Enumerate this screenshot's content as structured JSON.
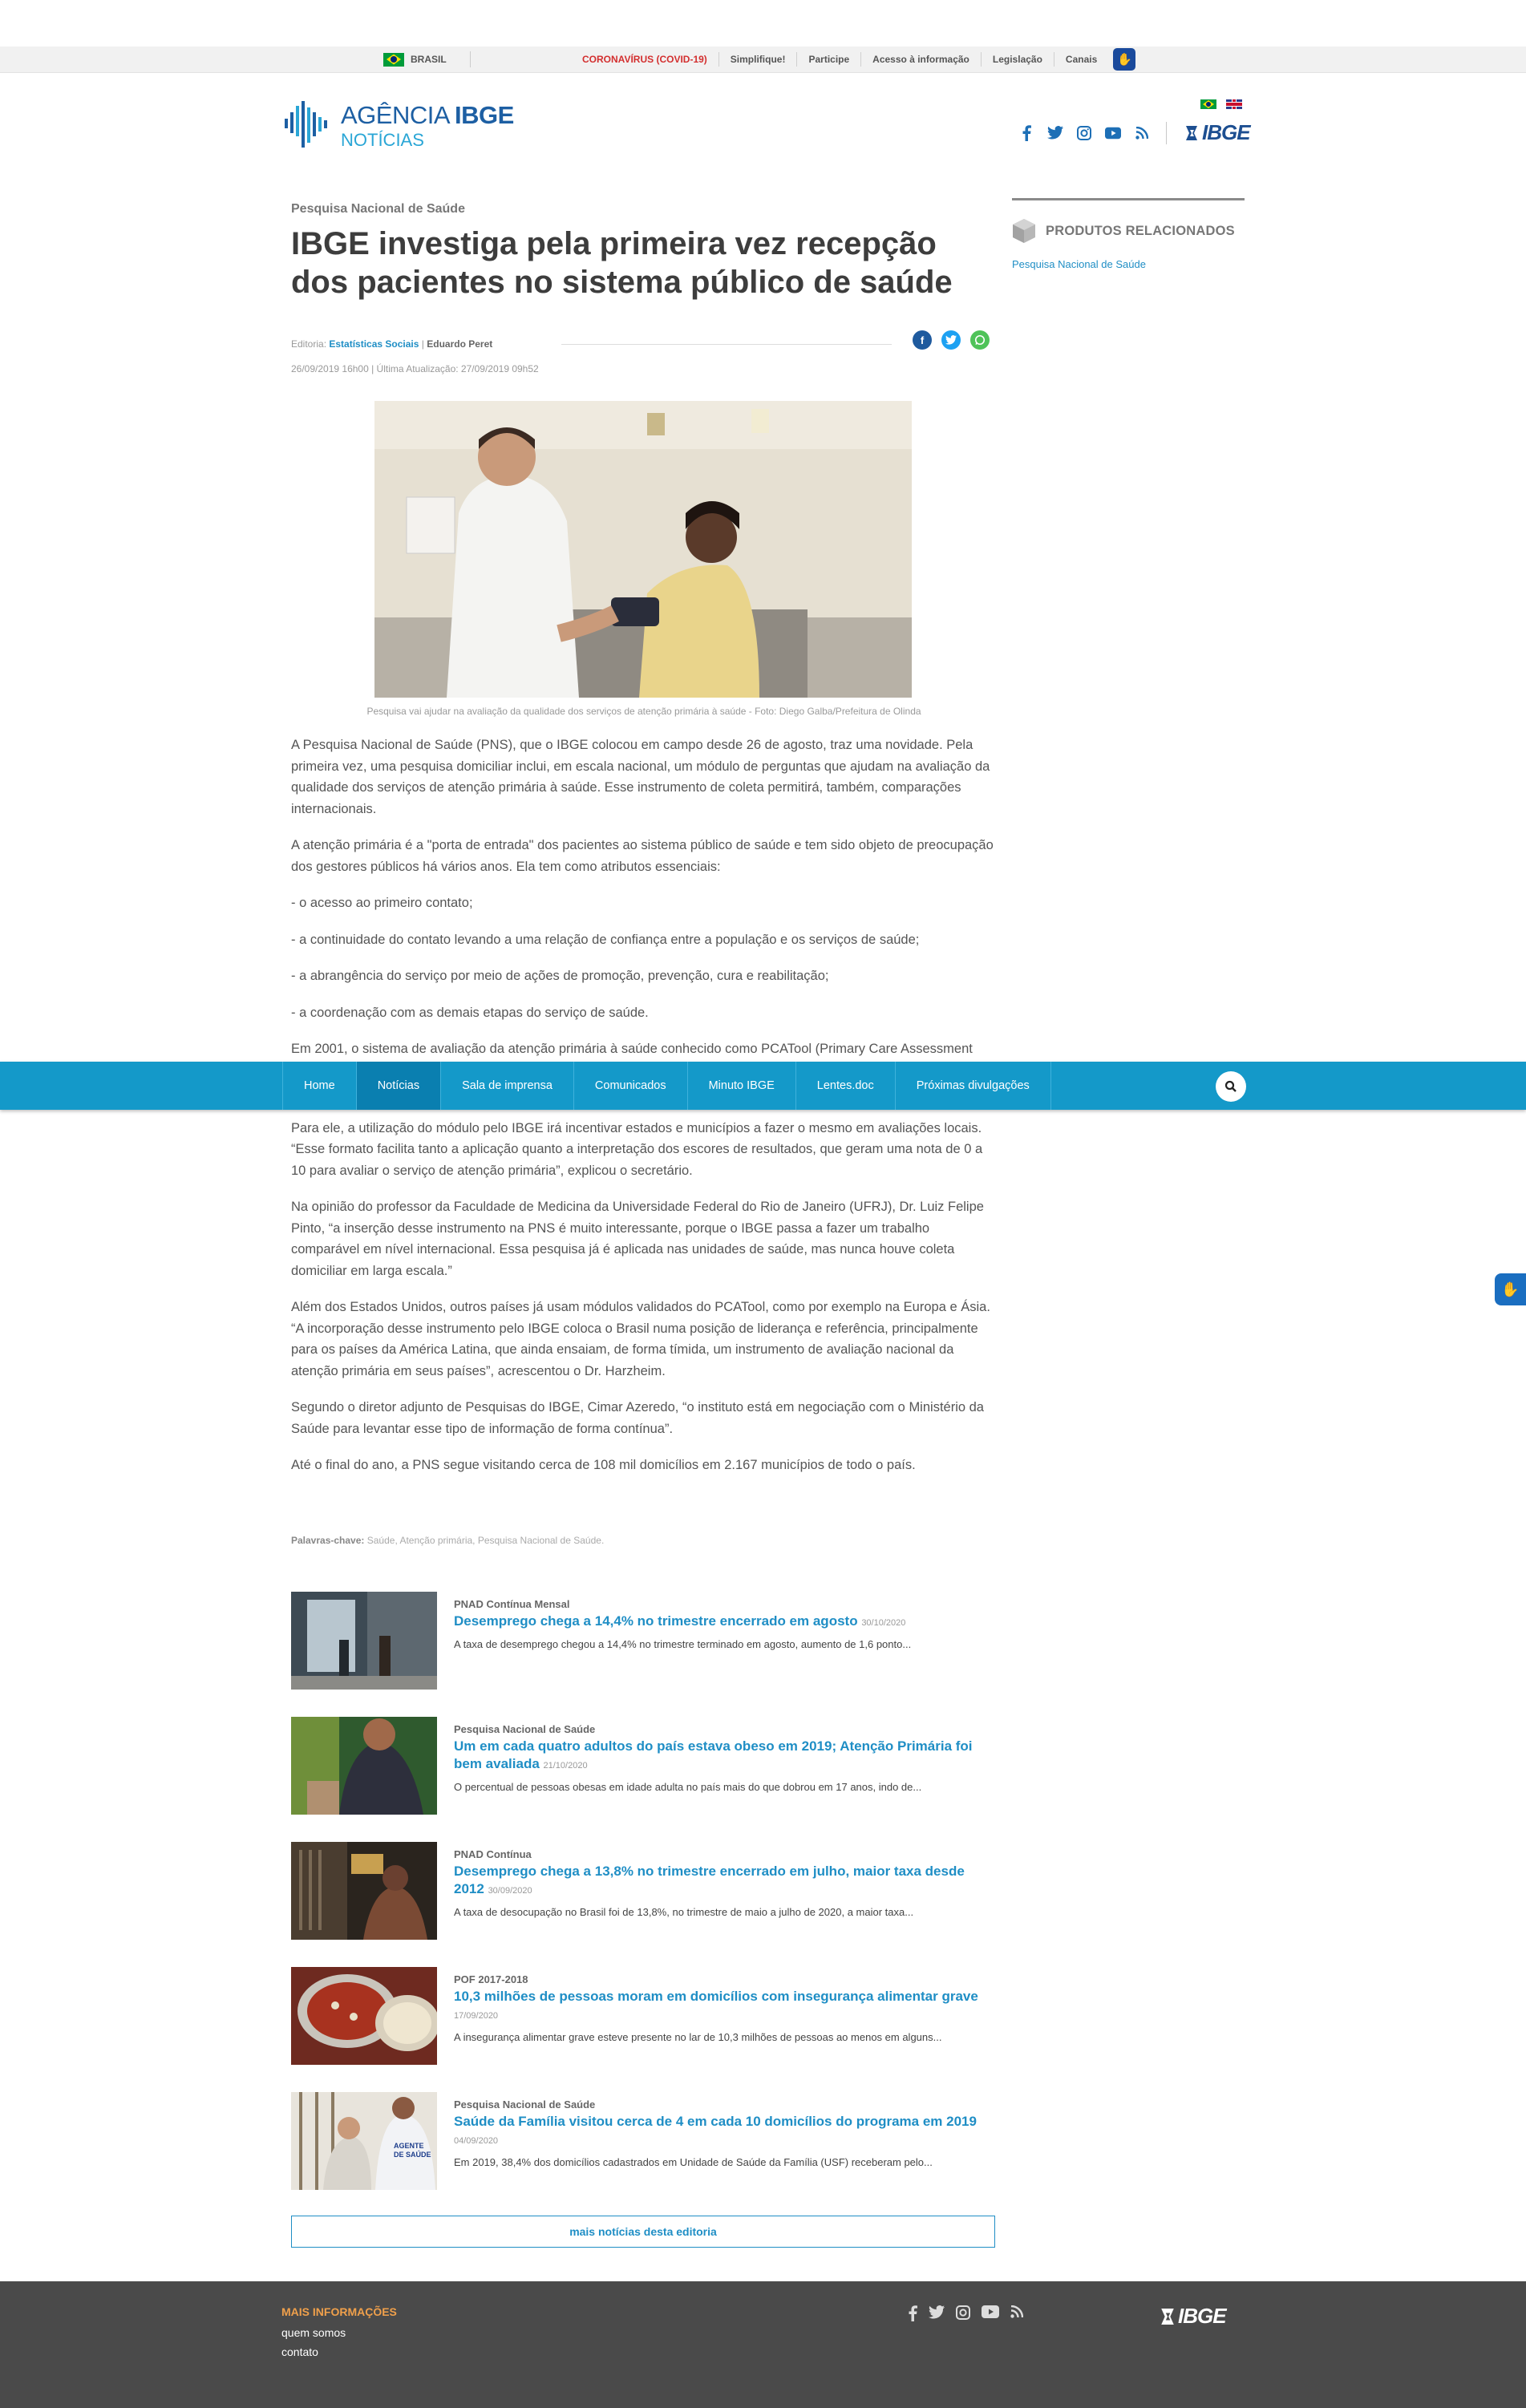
{
  "govbar": {
    "country": "BRASIL",
    "links": [
      "CORONAVÍRUS (COVID-19)",
      "Simplifique!",
      "Participe",
      "Acesso à informação",
      "Legislação",
      "Canais"
    ]
  },
  "header": {
    "logo_line1_a": "AGÊNCIA",
    "logo_line1_b": "IBGE",
    "logo_line2": "NOTÍCIAS",
    "brand": "IBGE"
  },
  "article": {
    "kicker": "Pesquisa Nacional de Saúde",
    "title": "IBGE investiga pela primeira vez recepção dos pacientes no sistema público de saúde",
    "editoria_label": "Editoria:",
    "editoria": "Estatísticas Sociais",
    "author_sep": "|",
    "author": "Eduardo Peret",
    "dates": "26/09/2019 16h00 | Última Atualização: 27/09/2019 09h52",
    "caption": "Pesquisa vai ajudar na avaliação da qualidade dos serviços de atenção primária à saúde - Foto: Diego Galba/Prefeitura de Olinda",
    "paragraphs": [
      "A Pesquisa Nacional de Saúde (PNS), que o IBGE colocou em campo desde 26 de agosto, traz uma novidade. Pela primeira vez, uma pesquisa domiciliar inclui, em escala nacional, um módulo de perguntas que ajudam na avaliação da qualidade dos serviços de atenção primária à saúde. Esse instrumento de coleta permitirá, também, comparações internacionais.",
      "A atenção primária é a \"porta de entrada\" dos pacientes ao sistema público de saúde e tem sido objeto de preocupação dos gestores públicos há vários anos. Ela tem como atributos essenciais:",
      "- o acesso ao primeiro contato;",
      "- a continuidade do contato levando a uma relação de confiança entre a população e os serviços de saúde;",
      "- a abrangência do serviço por meio de ações de promoção, prevenção, cura e reabilitação;",
      "- a coordenação com as demais etapas do serviço de saúde.",
      "Em 2001, o sistema de avaliação da atenção primária à saúde conhecido como PCATool (Primary Care Assessment Tool) foi desenvolvido nos Estados Unidos, e trazido ao Brasil, segundo o secretário do Ministério da Saúde, Dr. Erno Harzheim.",
      "Para ele, a utilização do módulo pelo IBGE irá incentivar estados e municípios a fazer o mesmo em avaliações locais. “Esse formato facilita tanto a aplicação quanto a interpretação dos escores de resultados, que geram uma nota de 0 a 10 para avaliar o serviço de atenção primária”, explicou o secretário.",
      "Na opinião do professor da Faculdade de Medicina da Universidade Federal do Rio de Janeiro (UFRJ), Dr. Luiz Felipe Pinto, “a inserção desse instrumento na PNS é muito interessante, porque o IBGE passa a fazer um trabalho comparável em nível internacional. Essa pesquisa já é aplicada nas unidades de saúde, mas nunca houve coleta domiciliar em larga escala.”",
      "Além dos Estados Unidos, outros países já usam módulos validados do PCATool, como por exemplo na Europa e Ásia. “A incorporação desse instrumento pelo IBGE coloca o Brasil numa posição de liderança e referência, principalmente para os países da América Latina, que ainda ensaiam, de forma tímida, um instrumento de avaliação nacional da atenção primária em seus países”, acrescentou o Dr. Harzheim.",
      "Segundo o diretor adjunto de Pesquisas do IBGE, Cimar Azeredo, “o instituto está em negociação com o Ministério da Saúde para levantar esse tipo de informação de forma contínua”.",
      "Até o final do ano, a PNS segue visitando cerca de 108 mil domicílios em 2.167 municípios de todo o país."
    ],
    "keywords_label": "Palavras-chave:",
    "keywords": "Saúde, Atenção primária, Pesquisa Nacional de Saúde."
  },
  "menu": [
    "Home",
    "Notícias",
    "Sala de imprensa",
    "Comunicados",
    "Minuto IBGE",
    "Lentes.doc",
    "Próximas divulgações"
  ],
  "related": [
    {
      "category": "PNAD Contínua Mensal",
      "title": "Desemprego chega a 14,4% no trimestre encerrado em agosto",
      "date": "30/10/2020",
      "summary": "A taxa de desemprego chegou a 14,4% no trimestre terminado em agosto, aumento de 1,6 ponto..."
    },
    {
      "category": "Pesquisa Nacional de Saúde",
      "title": "Um em cada quatro adultos do país estava obeso em 2019; Atenção Primária foi bem avaliada",
      "date": "21/10/2020",
      "summary": "O percentual de pessoas obesas em idade adulta no país mais do que dobrou em 17 anos, indo de..."
    },
    {
      "category": "PNAD Contínua",
      "title": "Desemprego chega a 13,8% no trimestre encerrado em julho, maior taxa desde 2012",
      "date": "30/09/2020",
      "summary": "A taxa de desocupação no Brasil foi de 13,8%, no trimestre de maio a julho de 2020, a maior taxa..."
    },
    {
      "category": "POF 2017-2018",
      "title": "10,3 milhões de pessoas moram em domicílios com insegurança alimentar grave",
      "date": "17/09/2020",
      "summary": "A insegurança alimentar grave esteve presente no lar de 10,3 milhões de pessoas ao menos em alguns..."
    },
    {
      "category": "Pesquisa Nacional de Saúde",
      "title": "Saúde da Família visitou cerca de 4 em cada 10 domicílios do programa em 2019",
      "date": "04/09/2020",
      "summary": "Em 2019, 38,4% dos domicílios cadastrados em Unidade de Saúde da Família (USF) receberam pelo..."
    }
  ],
  "more_button": "mais notícias desta editoria",
  "sidebar": {
    "title": "PRODUTOS RELACIONADOS",
    "link": "Pesquisa Nacional de Saúde"
  },
  "footer": {
    "heading": "MAIS INFORMAÇÕES",
    "links": [
      "quem somos",
      "contato"
    ],
    "brand": "IBGE"
  },
  "colors": {
    "menu": "#1499c9",
    "link": "#1f8ec5",
    "footer": "#4a4a4a",
    "accent": "#f0a04b"
  }
}
